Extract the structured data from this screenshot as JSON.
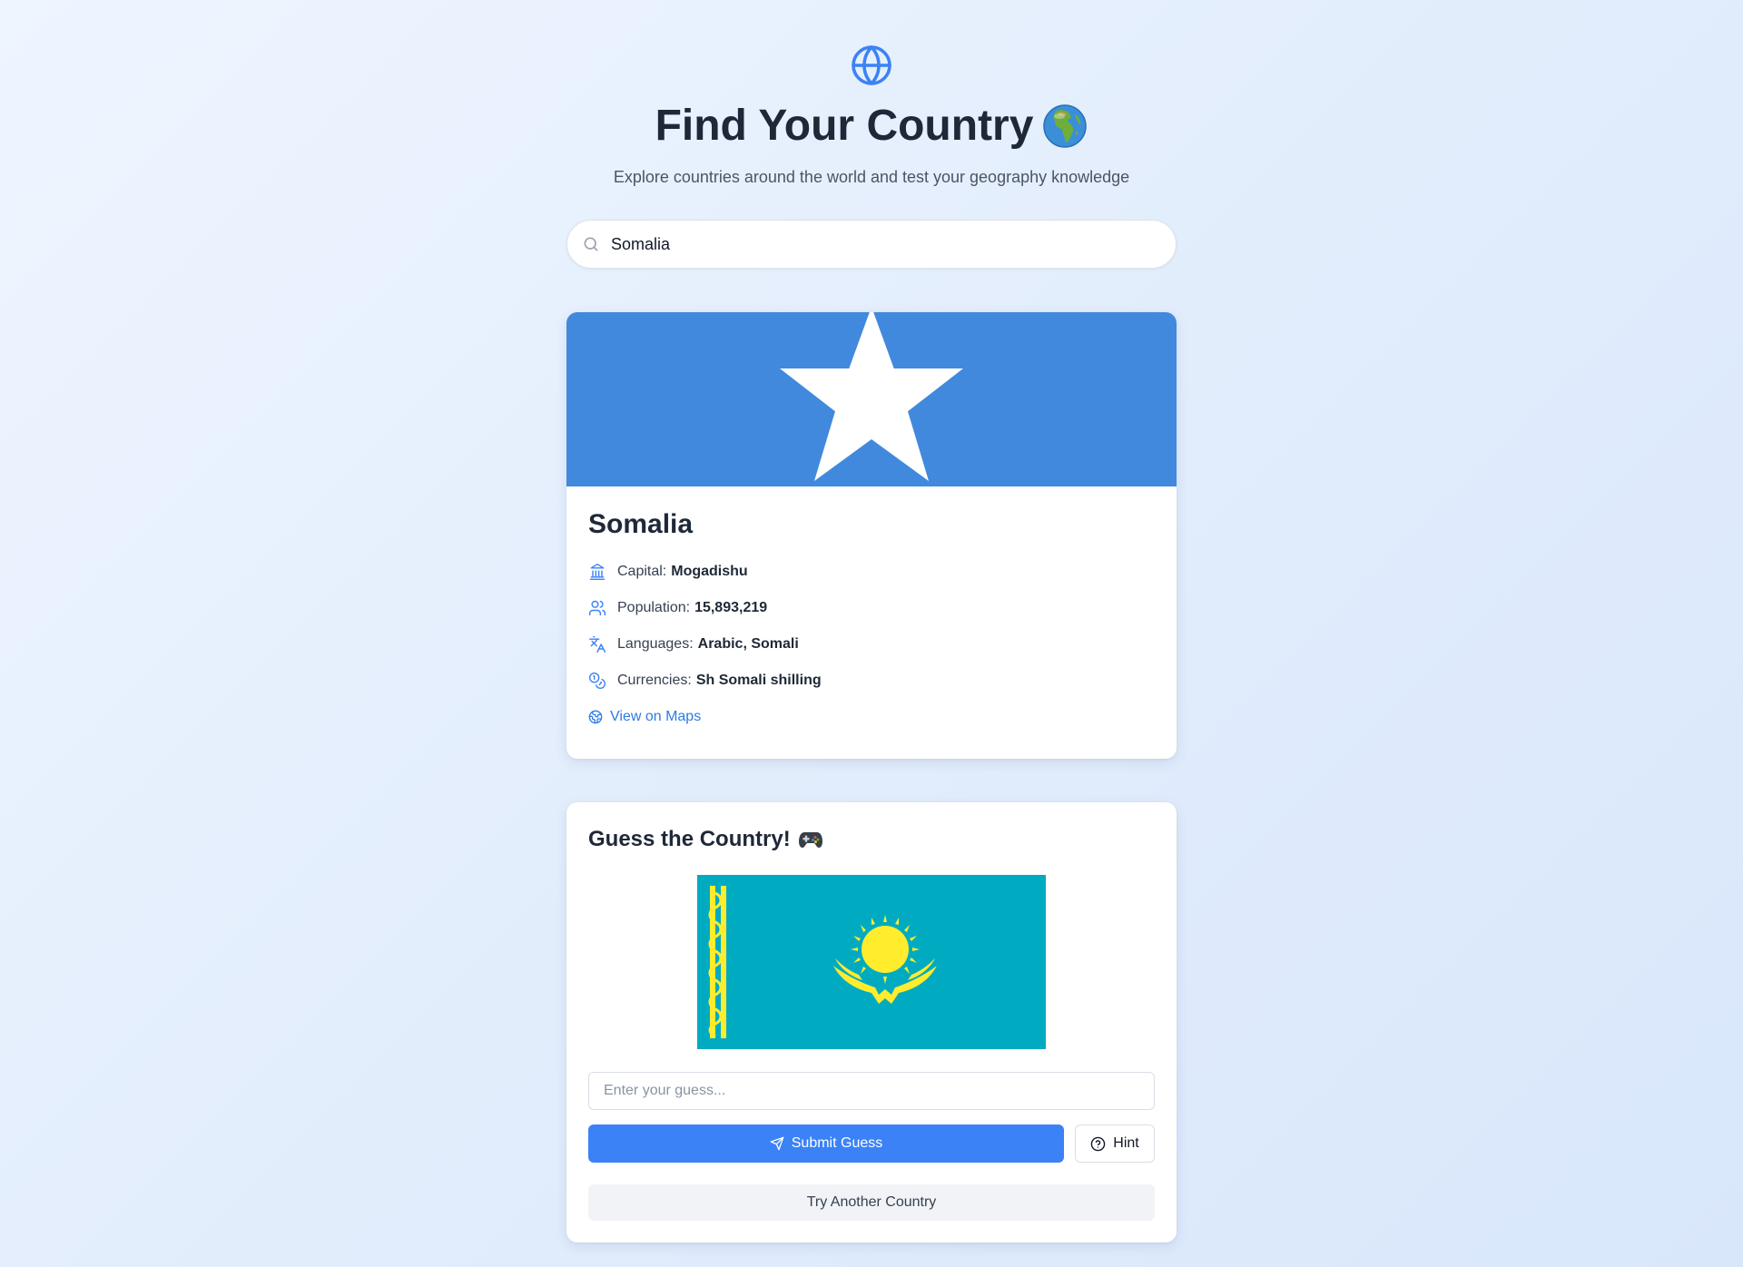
{
  "header": {
    "icon": "globe-icon",
    "title": "Find Your Country",
    "title_emoji": "earth-africa-emoji",
    "subtitle": "Explore countries around the world and test your geography knowledge"
  },
  "search": {
    "value": "Somalia",
    "placeholder": "",
    "icon": "search-icon"
  },
  "country": {
    "flag": "somalia-flag",
    "flag_colors": {
      "field": "#4189dd",
      "star": "#ffffff"
    },
    "name": "Somalia",
    "capital_label": "Capital:",
    "capital_value": "Mogadishu",
    "population_label": "Population:",
    "population_value": "15,893,219",
    "languages_label": "Languages:",
    "languages_value": "Arabic, Somali",
    "currencies_label": "Currencies:",
    "currencies_value": "Sh Somali shilling",
    "maps_link": "View on Maps"
  },
  "game": {
    "title": "Guess the Country!",
    "title_icon": "gamepad-icon",
    "flag": "kazakhstan-flag",
    "flag_colors": {
      "field": "#00abc2",
      "emblem": "#ffec2d"
    },
    "guess_value": "",
    "guess_placeholder": "Enter your guess...",
    "submit_label": "Submit Guess",
    "hint_label": "Hint",
    "another_label": "Try Another Country"
  },
  "colors": {
    "accent": "#3b82f6",
    "link": "#2f7be0",
    "heading": "#1e2838"
  }
}
